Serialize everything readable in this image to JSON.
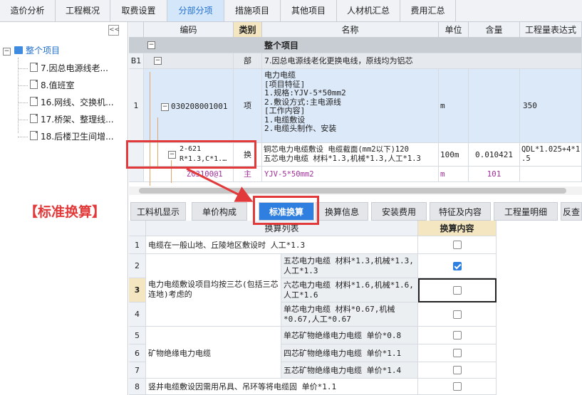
{
  "top_tabs": [
    "造价分析",
    "工程概况",
    "取费设置",
    "分部分项",
    "措施项目",
    "其他项目",
    "人材机汇总",
    "费用汇总"
  ],
  "active_top_tab": "分部分项",
  "tree": {
    "collapse_label": "<<",
    "root": "整个项目",
    "items": [
      "7.因总电源线老...",
      "8.值班室",
      "16.网线、交换机...",
      "17.桥架、整理线...",
      "18.后楼卫生间增..."
    ]
  },
  "annotation": "【标准换算】",
  "upper_grid": {
    "headers": [
      "编码",
      "类别",
      "名称",
      "单位",
      "含量",
      "工程量表达式"
    ],
    "row_whole": {
      "title": "整个项目"
    },
    "row_b1": {
      "num": "B1",
      "type": "部",
      "name": "7.因总电源线老化更换电线，原线均为铝芯"
    },
    "row_1": {
      "num": "1",
      "code": "030208001001",
      "type": "项",
      "name_lines": [
        "电力电缆",
        "[项目特征]",
        "1.规格:YJV-5*50mm2",
        "2.敷设方式:主电源线",
        "[工作内容]",
        "1.电缆敷设",
        "2.电缆头制作、安装"
      ],
      "unit": "m",
      "expr": "350"
    },
    "row_2621": {
      "code": "2-621",
      "code_sub": "R*1.3,C*1.…",
      "type": "换",
      "name_lines": [
        "铜芯电力电缆敷设 电缆截面(mm2以下)120",
        "五芯电力电缆 材料*1.3,机械*1.3,人工*1.3"
      ],
      "unit": "100m",
      "content": "0.010421",
      "expr_lines": [
        "QDL*1.025+4*1",
        ".5"
      ]
    },
    "row_main": {
      "code": "Z03100@1",
      "type": "主",
      "name": "YJV-5*50mm2",
      "unit": "m",
      "content": "101"
    }
  },
  "lower_tabs": [
    "工料机显示",
    "单价构成",
    "标准换算",
    "换算信息",
    "安装费用",
    "特征及内容",
    "工程量明细",
    "反查"
  ],
  "active_lower_tab": "标准换算",
  "lower_grid": {
    "headers": [
      "换算列表",
      "换算内容"
    ],
    "rows": [
      {
        "num": "1",
        "group": "电缆在一般山地、丘陵地区敷设时 人工*1.3",
        "option": "",
        "checked": false
      },
      {
        "num": "2",
        "group": "",
        "option": "五芯电力电缆 材料*1.3,机械*1.3,人工*1.3",
        "checked": true
      },
      {
        "num": "3",
        "group": "电力电缆敷设项目均按三芯(包括三芯连地)考虑的",
        "option": "六芯电力电缆 材料*1.6,机械*1.6,人工*1.6",
        "checked": false
      },
      {
        "num": "4",
        "group": "",
        "option": "单芯电力电缆 材料*0.67,机械*0.67,人工*0.67",
        "checked": false
      },
      {
        "num": "5",
        "group": "",
        "option": "单芯矿物绝缘电力电缆 单价*0.8",
        "checked": false
      },
      {
        "num": "6",
        "group": "矿物绝缘电力电缆",
        "option": "四芯矿物绝缘电力电缆 单价*1.1",
        "checked": false
      },
      {
        "num": "7",
        "group": "",
        "option": "五芯矿物绝缘电力电缆 单价*1.4",
        "checked": false
      },
      {
        "num": "8",
        "group": "竖井电缆敷设因需用吊具、吊环等将电缆固 单价*1.1",
        "option": "",
        "checked": false
      }
    ]
  },
  "colors": {
    "accent": "#2f7fe0",
    "annotation": "#e23a3a",
    "selected_row": "#dce9f9",
    "main_row": "#a0309a"
  }
}
